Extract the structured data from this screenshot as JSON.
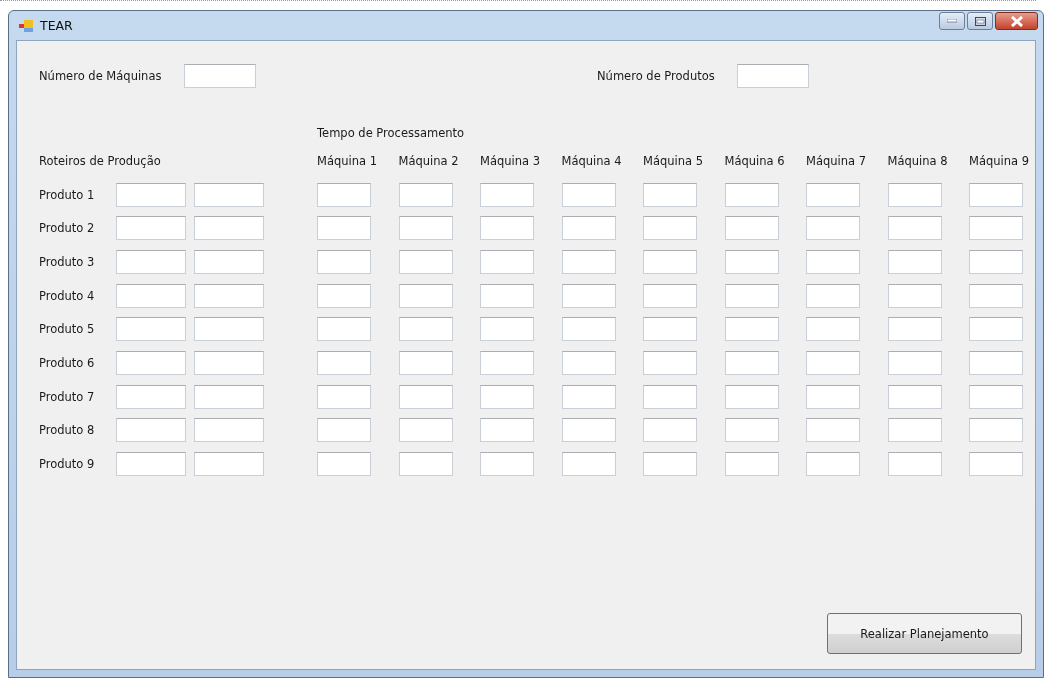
{
  "window": {
    "title": "TEAR"
  },
  "machine_count": {
    "label": "Número de Máquinas"
  },
  "product_count": {
    "label": "Número de Produtos"
  },
  "processing_time_title": "Tempo de Processamento",
  "routes_title": "Roteiros de Produção",
  "machine_headers": [
    "Máquina 1",
    "Máquina 2",
    "Máquina 3",
    "Máquina 4",
    "Máquina 5",
    "Máquina 6",
    "Máquina 7",
    "Máquina 8",
    "Máquina 9"
  ],
  "products": [
    {
      "label": "Produto 1"
    },
    {
      "label": "Produto 2"
    },
    {
      "label": "Produto 3"
    },
    {
      "label": "Produto 4"
    },
    {
      "label": "Produto 5"
    },
    {
      "label": "Produto 6"
    },
    {
      "label": "Produto 7"
    },
    {
      "label": "Produto 8"
    },
    {
      "label": "Produto 9"
    }
  ],
  "button": "Realizar Planejamento"
}
